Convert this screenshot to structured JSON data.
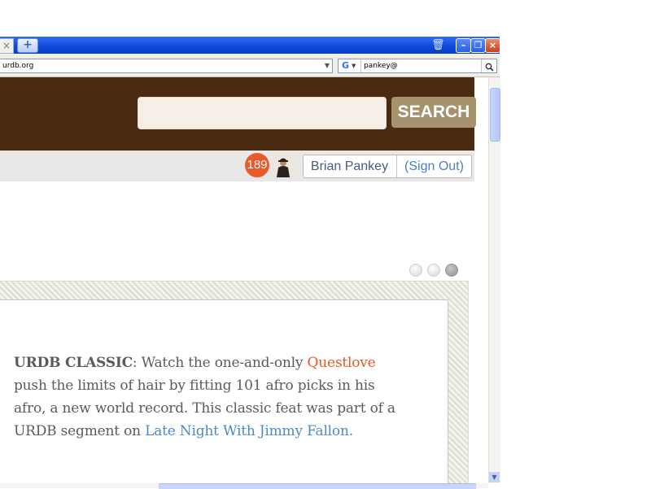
{
  "browser": {
    "tab_close_glyph": "×",
    "new_tab_glyph": "+",
    "url": "urdb.org",
    "search_engine_icon": "google-icon",
    "search_query": "pankey@"
  },
  "site": {
    "search_button_label": "SEARCH",
    "search_placeholder": "",
    "colors": {
      "header": "#4a2a10",
      "search_button": "#a6926d",
      "badge": "#e85a2a"
    }
  },
  "user": {
    "notification_count": "189",
    "name": "Brian Pankey",
    "sign_out_label": "(Sign Out)"
  },
  "carousel": {
    "dot_count": 3,
    "active_index": 2
  },
  "feature": {
    "label": "URDB CLASSIC",
    "text_1": ": Watch the one-and-only ",
    "link_1": "Questlove",
    "text_2": " push the limits of hair by fitting 101 afro picks in his afro, a new world record. This classic feat was part of a URDB segment on ",
    "link_2": "Late Night With Jimmy Fallon",
    "text_3": "."
  }
}
